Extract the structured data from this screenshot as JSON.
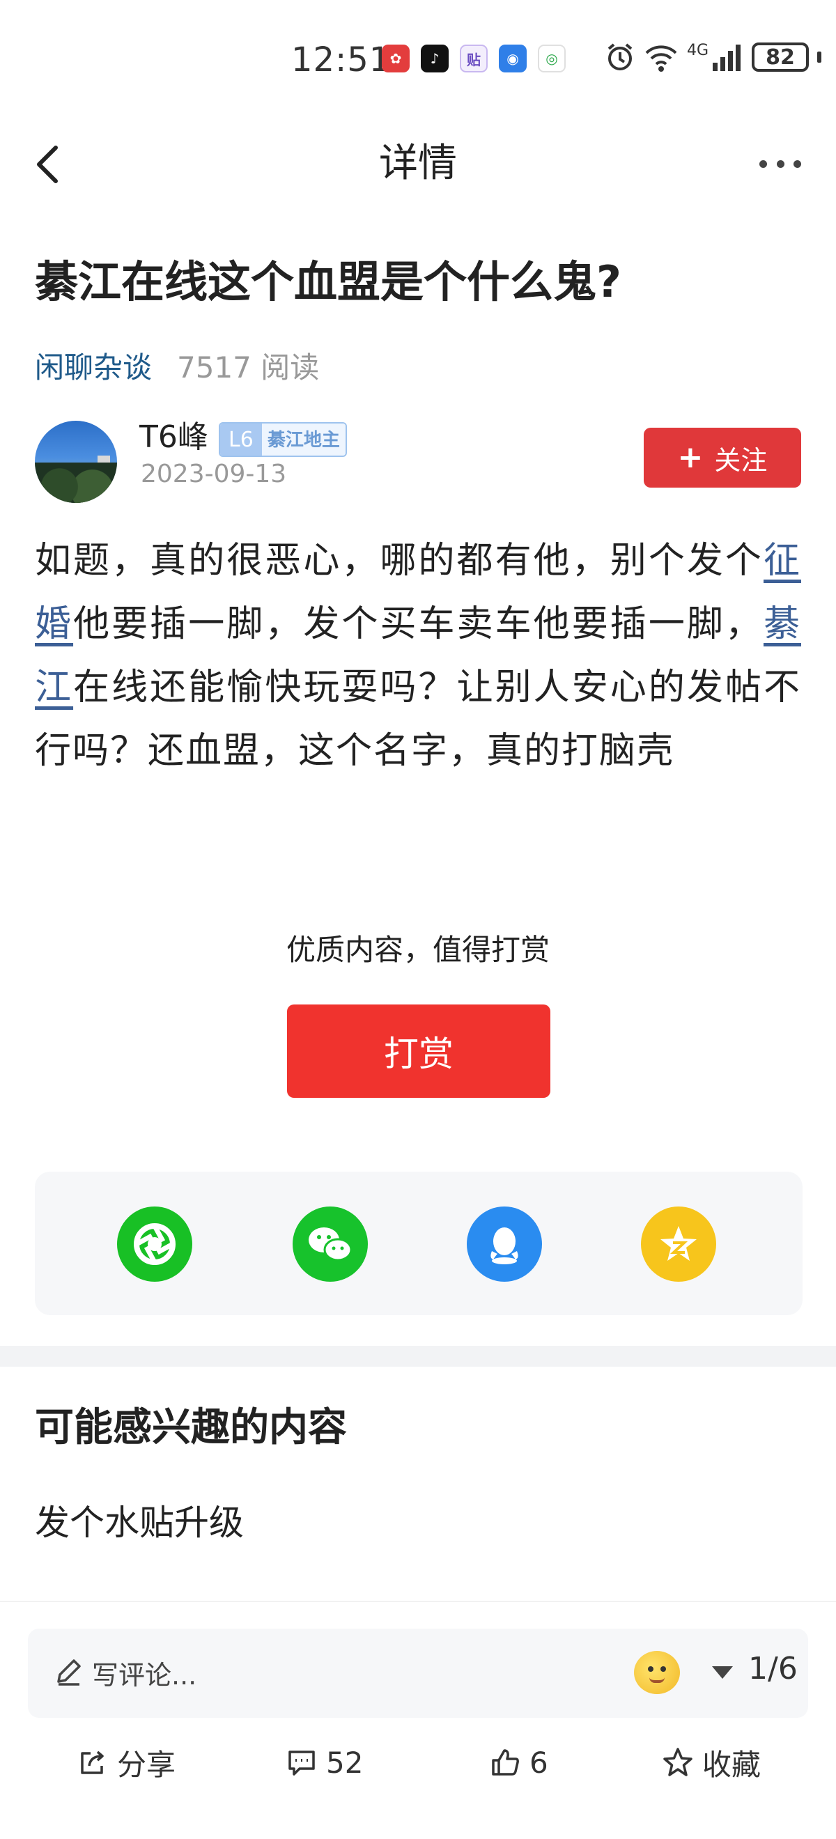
{
  "status_bar": {
    "time": "12:51",
    "network": "4G",
    "battery": "82"
  },
  "header": {
    "title": "详情"
  },
  "post": {
    "title": "綦江在线这个血盟是个什么鬼?",
    "category": "闲聊杂谈",
    "reads": "7517 阅读",
    "author": {
      "name": "T6峰",
      "level": "L6",
      "level_title": "綦江地主",
      "date": "2023-09-13"
    },
    "follow_label": "关注",
    "body": {
      "seg1": "如题，真的很恶心，哪的都有他，别个发个",
      "link1": "征婚",
      "seg2": "他要插一脚，发个买车卖车他要插一脚，",
      "link2": "綦江",
      "seg3": "在线还能愉快玩耍吗？让别人安心的发帖不行吗？还血盟，这个名字，真的打脑壳"
    }
  },
  "reward": {
    "hint": "优质内容，值得打赏",
    "button": "打赏"
  },
  "share_panel": {
    "icons": [
      "moments-icon",
      "wechat-icon",
      "qq-icon",
      "qzone-icon"
    ],
    "colors": {
      "moments": "#18c025",
      "wechat": "#17c22c",
      "qq": "#2a8cf0",
      "qzone": "#f7c51c"
    }
  },
  "recommend": {
    "heading": "可能感兴趣的内容",
    "items": [
      "发个水贴升级"
    ]
  },
  "comment_bar": {
    "placeholder": "写评论...",
    "page": "1/6"
  },
  "bottom_bar": {
    "share": "分享",
    "comments": "52",
    "likes": "6",
    "favorite": "收藏"
  },
  "colors": {
    "accent_red": "#e0383a",
    "link_blue": "#3c5f96",
    "category_blue": "#1f5a8a"
  }
}
